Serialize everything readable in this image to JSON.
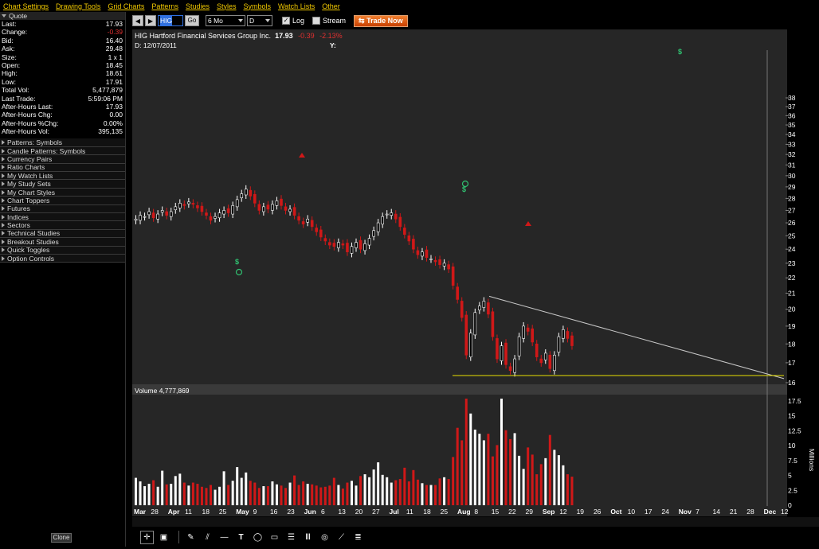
{
  "menu": [
    "Chart Settings",
    "Drawing Tools",
    "Grid Charts",
    "Patterns",
    "Studies",
    "Styles",
    "Symbols",
    "Watch Lists",
    "Other"
  ],
  "quote": {
    "header": "Quote",
    "rows": [
      {
        "label": "Last:",
        "value": "17.93",
        "neg": false
      },
      {
        "label": "Change:",
        "value": "-0.39",
        "neg": true
      },
      {
        "label": "Bid:",
        "value": "16.40",
        "neg": false
      },
      {
        "label": "Ask:",
        "value": "29.48",
        "neg": false
      },
      {
        "label": "Size:",
        "value": "1 x 1",
        "neg": false
      },
      {
        "label": "Open:",
        "value": "18.45",
        "neg": false
      },
      {
        "label": "High:",
        "value": "18.61",
        "neg": false
      },
      {
        "label": "Low:",
        "value": "17.91",
        "neg": false
      },
      {
        "label": "Total Vol:",
        "value": "5,477,879",
        "neg": false
      },
      {
        "label": "Last Trade:",
        "value": "5:59:06 PM",
        "neg": false
      },
      {
        "label": "After-Hours Last:",
        "value": "17.93",
        "neg": false
      },
      {
        "label": "After-Hours Chg:",
        "value": "0.00",
        "neg": false
      },
      {
        "label": "After-Hours %Chg:",
        "value": "0.00%",
        "neg": false
      },
      {
        "label": "After-Hours Vol:",
        "value": "395,135",
        "neg": false
      }
    ]
  },
  "sections": [
    "Patterns: Symbols",
    "Candle Patterns: Symbols",
    "Currency Pairs",
    "Ratio Charts",
    "My Watch Lists",
    "My Study Sets",
    "My Chart Styles",
    "Chart Toppers",
    "Futures",
    "Indices",
    "Sectors",
    "Technical Studies",
    "Breakout Studies",
    "Quick Toggles",
    "Option Controls"
  ],
  "clone_label": "Clone",
  "toolbar": {
    "symbol": "HIG",
    "go_label": "Go",
    "period": "6 Mo",
    "interval": "D",
    "log_label": "Log",
    "log_checked": true,
    "stream_label": "Stream",
    "stream_checked": false,
    "trade_label": "Trade Now"
  },
  "chart_header": {
    "title": "HIG Hartford Financial Services Group Inc.",
    "last": "17.93",
    "change": "-0.39",
    "change_pct": "-2.13%",
    "date": "D: 12/07/2011",
    "y_label": "Y:",
    "volume_label": "Volume 4,777,869"
  },
  "colors": {
    "up": "#ffffff",
    "down": "#d01818",
    "trendline": "#c8c8c8",
    "support": "#e8e000",
    "background": "#262626"
  },
  "chart_data": {
    "type": "candlestick",
    "price_axis": {
      "ticks": [
        16,
        17,
        18,
        19,
        20,
        21,
        22,
        23,
        24,
        25,
        26,
        27,
        28,
        29,
        30,
        31,
        32,
        33,
        34,
        35,
        36,
        37,
        38
      ],
      "scale": "log"
    },
    "volume_axis": {
      "ticks": [
        "0",
        "2.5",
        "5",
        "7.5",
        "10",
        "12.5",
        "15",
        "17.5"
      ],
      "unit_label": "Millions"
    },
    "x_labels": [
      "Mar",
      "28",
      "Apr",
      "11",
      "18",
      "25",
      "May",
      "9",
      "16",
      "23",
      "Jun",
      "6",
      "13",
      "20",
      "27",
      "Jul",
      "11",
      "18",
      "25",
      "Aug",
      "8",
      "15",
      "22",
      "29",
      "Sep",
      "12",
      "19",
      "26",
      "Oct",
      "10",
      "17",
      "24",
      "Nov",
      "7",
      "14",
      "21",
      "28",
      "Dec",
      "12"
    ],
    "closes": [
      26.3,
      26.6,
      26.5,
      26.9,
      26.4,
      26.7,
      27.0,
      26.6,
      26.9,
      27.3,
      27.6,
      27.4,
      27.7,
      27.5,
      27.2,
      26.9,
      26.6,
      26.2,
      26.5,
      26.8,
      27.0,
      26.8,
      27.4,
      27.9,
      28.4,
      28.8,
      28.2,
      27.6,
      27.0,
      27.3,
      27.1,
      27.5,
      27.8,
      27.4,
      27.0,
      27.1,
      26.6,
      26.2,
      25.9,
      26.3,
      25.7,
      25.3,
      24.9,
      24.6,
      24.3,
      24.2,
      24.5,
      24.3,
      23.8,
      24.2,
      24.5,
      24.0,
      24.4,
      24.8,
      25.4,
      26.0,
      26.5,
      26.7,
      26.8,
      26.3,
      25.7,
      25.1,
      24.6,
      24.0,
      23.6,
      23.8,
      23.4,
      23.3,
      23.1,
      22.9,
      23.0,
      22.6,
      21.5,
      20.6,
      19.5,
      17.4,
      18.6,
      19.8,
      20.2,
      20.5,
      19.7,
      18.4,
      17.2,
      17.9,
      16.9,
      16.6,
      17.2,
      18.4,
      19.0,
      18.7,
      18.1,
      17.3,
      17.0,
      17.5,
      16.7,
      17.4,
      18.4,
      18.8,
      18.3,
      17.9
    ],
    "volumes": [
      4.6,
      4.0,
      3.2,
      3.6,
      4.2,
      3.1,
      5.8,
      3.5,
      3.6,
      4.9,
      5.3,
      3.8,
      3.3,
      3.8,
      3.6,
      3.1,
      2.9,
      3.4,
      2.6,
      3.1,
      5.7,
      3.4,
      4.1,
      6.4,
      4.6,
      5.5,
      4.1,
      3.8,
      2.9,
      3.2,
      3.2,
      4.0,
      3.5,
      3.3,
      2.9,
      3.8,
      5.0,
      3.4,
      4.0,
      3.6,
      3.5,
      3.3,
      3.0,
      3.1,
      3.3,
      4.6,
      3.4,
      2.8,
      3.8,
      4.1,
      3.3,
      4.9,
      5.2,
      4.7,
      6.0,
      7.2,
      5.1,
      4.7,
      3.8,
      4.2,
      4.4,
      6.3,
      4.0,
      5.9,
      4.3,
      3.7,
      3.4,
      3.4,
      3.4,
      4.5,
      4.7,
      4.4,
      8.1,
      13.0,
      10.9,
      17.9,
      15.4,
      12.7,
      12.0,
      10.9,
      12.0,
      8.2,
      10.1,
      17.9,
      12.6,
      11.1,
      12.1,
      8.3,
      6.1,
      9.7,
      8.5,
      5.2,
      6.9,
      7.9,
      11.8,
      9.3,
      8.4,
      6.7,
      5.2,
      4.8
    ],
    "events": [
      "$",
      "$",
      "$"
    ]
  }
}
